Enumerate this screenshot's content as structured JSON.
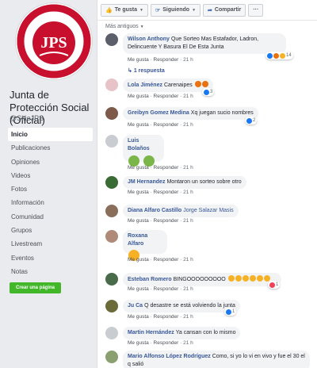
{
  "page": {
    "title": "Junta de Protección Social (Oficial)",
    "handle": "@SitioJPS",
    "logo_text": "Junta de Protección Social",
    "logo_initials": "JPS",
    "logo_tagline": "Solidaridad, Bienestar... ¡Para Todos!",
    "create_button": "Crear una página"
  },
  "nav": [
    {
      "label": "Inicio"
    },
    {
      "label": "Publicaciones"
    },
    {
      "label": "Opiniones"
    },
    {
      "label": "Videos"
    },
    {
      "label": "Fotos"
    },
    {
      "label": "Información"
    },
    {
      "label": "Comunidad"
    },
    {
      "label": "Grupos"
    },
    {
      "label": "Livestream"
    },
    {
      "label": "Eventos"
    },
    {
      "label": "Notas"
    }
  ],
  "toolbar": {
    "like": "Te gusta",
    "follow": "Siguiendo",
    "share": "Compartir",
    "more": "···"
  },
  "sort_label": "Más antiguos",
  "actions": {
    "like": "Me gusta",
    "reply": "Responder",
    "sep": " · "
  },
  "comments": [
    {
      "author": "Wilson Anthony",
      "text": "Que Sorteo Mas Estafador, Ladron, Delincuente Y Basura El De Esta Junta",
      "time": "21 h",
      "reactions": "14",
      "replies": "1 respuesta"
    },
    {
      "author": "Lola Jiménez",
      "text": "Carenaipes",
      "time": "21 h",
      "reactions": "3"
    },
    {
      "author": "Greibyn Gomez Medina",
      "text": "Xq juegan sucio nombres",
      "time": "21 h",
      "reactions": "2"
    },
    {
      "author": "Luis Bolaños",
      "text": "",
      "time": "21 h"
    },
    {
      "author": "JM Hernandez",
      "text": "Montaron un sorteo sobre otro",
      "time": "21 h"
    },
    {
      "author": "Diana Alfaro Castillo",
      "text": "Jorge Salazar Masis",
      "time": "21 h"
    },
    {
      "author": "Roxana Alfaro",
      "text": "",
      "time": "21 h"
    },
    {
      "author": "Esteban Romero",
      "text": "BINGOOOOOOOOO",
      "time": "21 h",
      "reactions": "1"
    },
    {
      "author": "Ju Ca",
      "text": "Q desastre se está volviendo la junta",
      "time": "21 h",
      "reactions": "1"
    },
    {
      "author": "Martin Hernández",
      "text": "Ya cansan con lo mismo",
      "time": "21 h"
    },
    {
      "author": "Mario Alfonso López Rodríguez",
      "text": "Como, si yo lo vi en vivo y fue el 30 el q salió",
      "time": ""
    }
  ],
  "colors": {
    "link": "#385898",
    "brand_red": "#c8102e",
    "create_green": "#42b72a"
  }
}
